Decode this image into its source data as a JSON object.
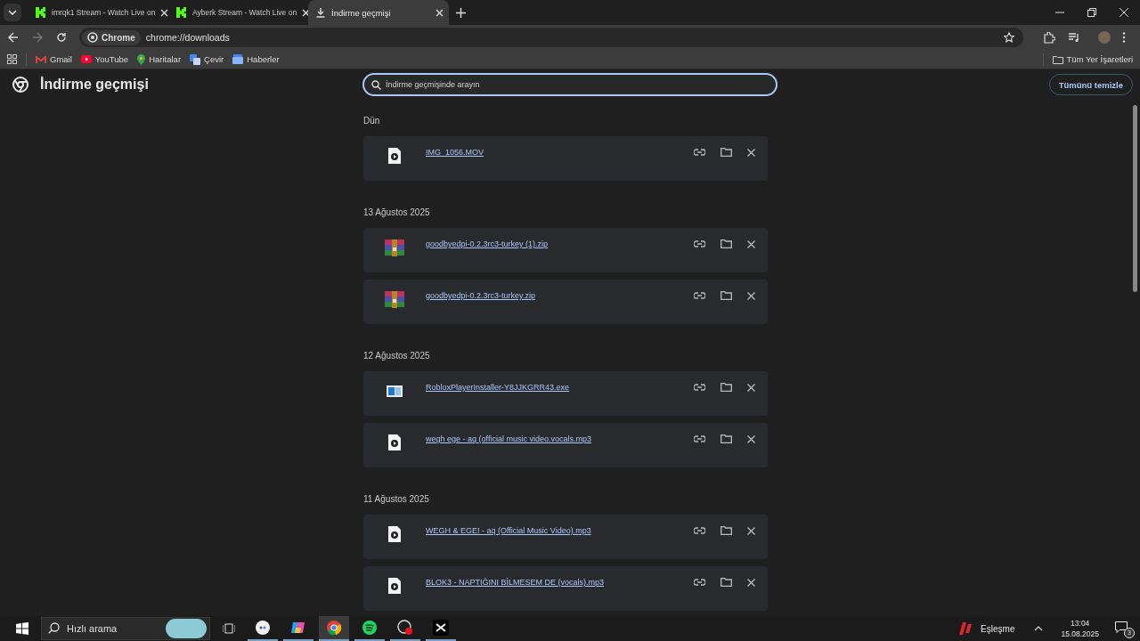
{
  "tabs": [
    {
      "label": "imrqk1 Stream - Watch Live on",
      "kind": "stream",
      "selected": false
    },
    {
      "label": "Ayberk Stream - Watch Live on",
      "kind": "stream",
      "selected": false
    },
    {
      "label": "İndirme geçmişi",
      "kind": "download",
      "selected": true
    }
  ],
  "address": {
    "chip": "Chrome",
    "url": "chrome://downloads"
  },
  "bookmarks": [
    {
      "label": "Gmail",
      "kind": "mail"
    },
    {
      "label": "YouTube",
      "kind": "video"
    },
    {
      "label": "Haritalar",
      "kind": "map"
    },
    {
      "label": "Çevir",
      "kind": "translate"
    },
    {
      "label": "Haberler",
      "kind": "news"
    }
  ],
  "all_bookmarks": "Tüm Yer İşaretleri",
  "page": {
    "title": "İndirme geçmişi",
    "search_placeholder": "İndirme geçmişinde arayın",
    "clear_button": "Tümünü temizle"
  },
  "groups": [
    {
      "date": "Dün",
      "items": [
        {
          "name": "IMG_1056.MOV",
          "kind": "media"
        }
      ]
    },
    {
      "date": "13 Ağustos 2025",
      "items": [
        {
          "name": "goodbyedpi-0.2.3rc3-turkey (1).zip",
          "kind": "archive"
        },
        {
          "name": "goodbyedpi-0.2.3rc3-turkey.zip",
          "kind": "archive"
        }
      ]
    },
    {
      "date": "12 Ağustos 2025",
      "items": [
        {
          "name": "RobloxPlayerInstaller-Y8JJKGRR43.exe",
          "kind": "installer"
        },
        {
          "name": "wegh ege - aq (official music video.vocals.mp3",
          "kind": "media"
        }
      ]
    },
    {
      "date": "11 Ağustos 2025",
      "items": [
        {
          "name": "WEGH & EGE! - aq (Official Music Video).mp3",
          "kind": "media"
        },
        {
          "name": "BLOK3 - NAPTIĞINI BİLMESEM DE (vocals).mp3",
          "kind": "media"
        }
      ]
    }
  ],
  "taskbar": {
    "search_placeholder": "Hızlı arama",
    "apps": [
      {
        "kind": "assistant",
        "selected": false
      },
      {
        "kind": "copilot",
        "selected": false
      },
      {
        "kind": "chrome",
        "selected": true
      },
      {
        "kind": "spotify",
        "selected": false
      },
      {
        "kind": "recorder",
        "selected": false
      },
      {
        "kind": "editor",
        "selected": false
      }
    ],
    "weather": "Eşleşme",
    "time": "13:04",
    "date": "15.08.2025",
    "notifications": "3"
  }
}
